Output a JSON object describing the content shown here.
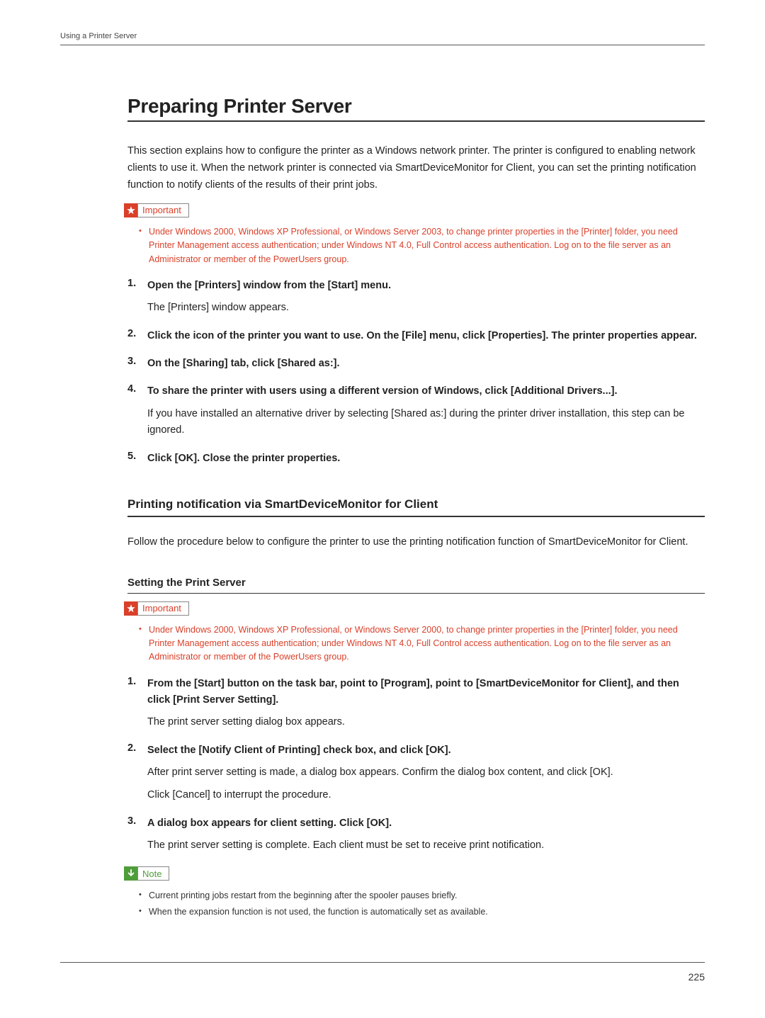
{
  "running_head": "Using a Printer Server",
  "page_number": "225",
  "h1": "Preparing Printer Server",
  "intro": "This section explains how to configure the printer as a Windows network printer. The printer is configured to enabling network clients to use it. When the network printer is connected via SmartDeviceMonitor for Client, you can set the printing notification function to notify clients of the results of their print jobs.",
  "callouts": {
    "important_label": "Important",
    "note_label": "Note"
  },
  "important1": "Under Windows 2000, Windows XP Professional, or Windows Server 2003, to change printer properties in the [Printer] folder, you need Printer Management access authentication; under Windows NT 4.0, Full Control access authentication. Log on to the file server as an Administrator or member of the PowerUsers group.",
  "steps1": [
    {
      "num": "1.",
      "head": "Open the [Printers] window from the [Start] menu.",
      "body": "The [Printers] window appears."
    },
    {
      "num": "2.",
      "head": "Click the icon of the printer you want to use. On the [File] menu, click [Properties]. The printer properties appear.",
      "body": ""
    },
    {
      "num": "3.",
      "head": "On the [Sharing] tab, click [Shared as:].",
      "body": ""
    },
    {
      "num": "4.",
      "head": "To share the printer with users using a different version of Windows, click [Additional Drivers...].",
      "body": "If you have installed an alternative driver by selecting [Shared as:] during the printer driver installation, this step can be ignored."
    },
    {
      "num": "5.",
      "head": "Click [OK]. Close the printer properties.",
      "body": ""
    }
  ],
  "h2": "Printing notification via SmartDeviceMonitor for Client",
  "h2_intro": "Follow the procedure below to configure the printer to use the printing notification function of SmartDeviceMonitor for Client.",
  "h3": "Setting the Print Server",
  "important2": "Under Windows 2000, Windows XP Professional, or Windows Server 2000, to change printer properties in the [Printer] folder, you need Printer Management access authentication; under Windows NT 4.0, Full Control access authentication. Log on to the file server as an Administrator or member of the PowerUsers group.",
  "steps2": [
    {
      "num": "1.",
      "head": "From the [Start] button on the task bar, point to [Program], point to [SmartDeviceMonitor for Client], and then click [Print Server Setting].",
      "body": "The print server setting dialog box appears."
    },
    {
      "num": "2.",
      "head": "Select the [Notify Client of Printing] check box, and click [OK].",
      "body": "After print server setting is made, a dialog box appears. Confirm the dialog box content, and click [OK].",
      "body2": "Click [Cancel] to interrupt the procedure."
    },
    {
      "num": "3.",
      "head": "A dialog box appears for client setting. Click [OK].",
      "body": "The print server setting is complete. Each client must be set to receive print notification."
    }
  ],
  "notes": [
    "Current printing jobs restart from the beginning after the spooler pauses briefly.",
    "When the expansion function is not used, the function is automatically set as available."
  ]
}
